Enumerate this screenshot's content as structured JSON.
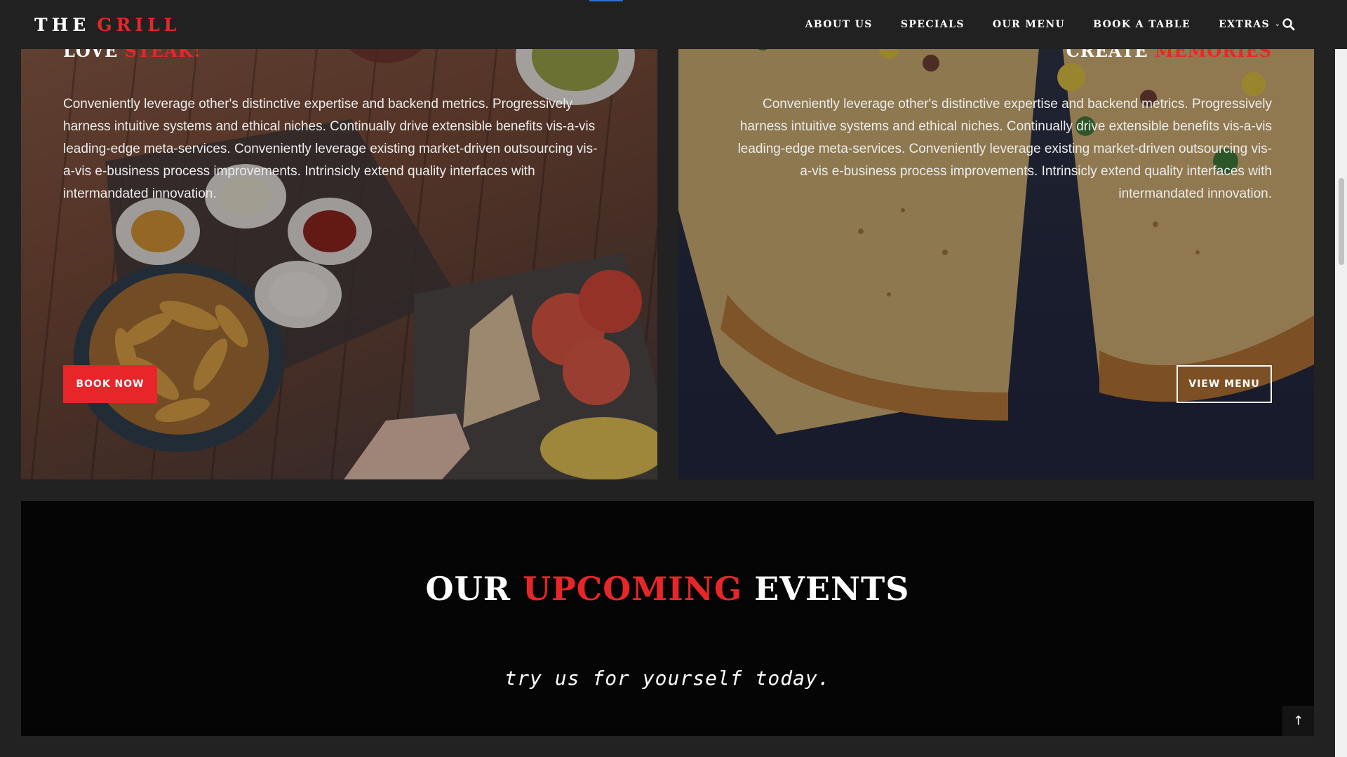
{
  "brand": {
    "logo_word1": "THE",
    "logo_word2": "GRILL"
  },
  "nav": {
    "items": [
      "ABOUT US",
      "SPECIALS",
      "OUR MENU",
      "BOOK A TABLE",
      "EXTRAS"
    ],
    "search_icon": "search-icon",
    "dropdown_icon": "chevron-down-icon"
  },
  "panels": [
    {
      "heading_white": "LOVE",
      "heading_red": "STEAK!",
      "text": "Conveniently leverage other's distinctive expertise and backend metrics. Progressively harness intuitive systems and ethical niches. Continually drive extensible benefits vis-a-vis leading-edge meta-services. Conveniently leverage existing market-driven outsourcing vis-a-vis e-business process improvements. Intrinsicly extend quality interfaces with intermandated innovation.",
      "button": "BOOK NOW"
    },
    {
      "heading_white": "CREATE",
      "heading_red": "MEMORIES",
      "text": "Conveniently leverage other's distinctive expertise and backend metrics. Progressively harness intuitive systems and ethical niches. Continually drive extensible benefits vis-a-vis leading-edge meta-services. Conveniently leverage existing market-driven outsourcing vis-a-vis e-business process improvements. Intrinsicly extend quality interfaces with intermandated innovation.",
      "button": "VIEW MENU"
    }
  ],
  "events": {
    "title_1": "OUR",
    "title_2": "UPCOMING",
    "title_3": "EVENTS",
    "subtitle": "try us for yourself today."
  },
  "back_to_top": {
    "icon": "arrow-up-icon",
    "glyph": "↑"
  },
  "colors": {
    "accent": "#e8262a",
    "header_bg": "#212121",
    "page_bg": "#222222",
    "events_bg": "#050505"
  }
}
